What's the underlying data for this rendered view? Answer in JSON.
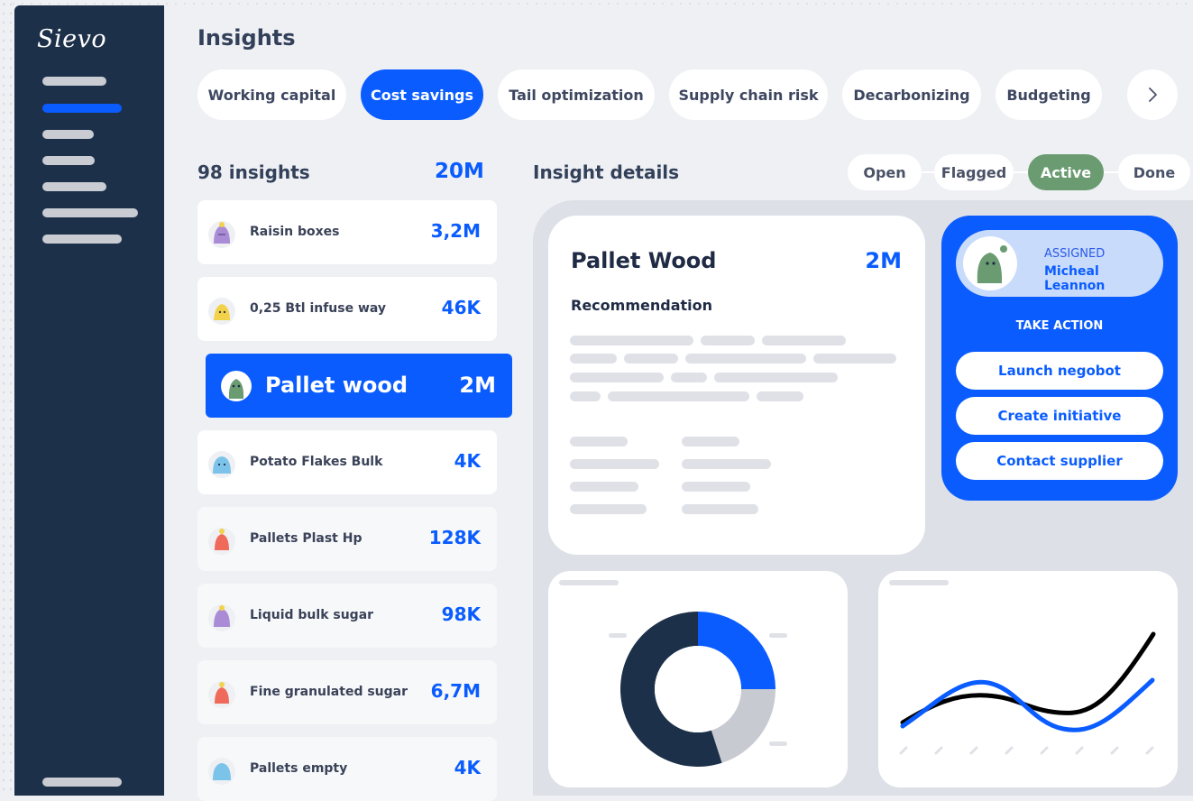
{
  "app": {
    "logo": "Sievo"
  },
  "sidebar": {
    "items": [
      "nav-item-1",
      "nav-item-2",
      "nav-item-3",
      "nav-item-4",
      "nav-item-5",
      "nav-item-6",
      "nav-item-7"
    ]
  },
  "header": {
    "title": "Insights"
  },
  "tabs": [
    {
      "label": "Working capital",
      "active": false
    },
    {
      "label": "Cost savings",
      "active": true
    },
    {
      "label": "Tail optimization",
      "active": false
    },
    {
      "label": "Supply chain risk",
      "active": false
    },
    {
      "label": "Decarbonizing",
      "active": false
    },
    {
      "label": "Budgeting",
      "active": false
    }
  ],
  "tabs_next_icon": "chevron-right-icon",
  "insights": {
    "count_label": "98 insights",
    "total": "20M",
    "items": [
      {
        "name": "Raisin boxes",
        "value": "3,2M",
        "avatar_color": "#a98bd6"
      },
      {
        "name": "0,25 Btl infuse way",
        "value": "46K",
        "avatar_color": "#f3d24b"
      },
      {
        "name": "Pallet wood",
        "value": "2M",
        "avatar_color": "#6a9b71",
        "selected": true
      },
      {
        "name": "Potato Flakes Bulk",
        "value": "4K",
        "avatar_color": "#7cc3ea"
      },
      {
        "name": "Pallets Plast Hp",
        "value": "128K",
        "avatar_color": "#ef6a5a"
      },
      {
        "name": "Liquid bulk sugar",
        "value": "98K",
        "avatar_color": "#a98bd6"
      },
      {
        "name": "Fine granulated sugar",
        "value": "6,7M",
        "avatar_color": "#ef6a5a"
      },
      {
        "name": "Pallets empty",
        "value": "4K",
        "avatar_color": "#7cc3ea"
      }
    ]
  },
  "details": {
    "title": "Insight details",
    "statuses": [
      {
        "label": "Open",
        "active": false
      },
      {
        "label": "Flagged",
        "active": false
      },
      {
        "label": "Active",
        "active": true
      },
      {
        "label": "Done",
        "active": false
      }
    ],
    "card": {
      "title": "Pallet Wood",
      "value": "2M",
      "subtitle": "Recommendation"
    },
    "assigned": {
      "label": "ASSIGNED",
      "name": "Micheal Leannon"
    },
    "take_action": "TAKE ACTION",
    "actions": [
      "Launch negobot",
      "Create initiative",
      "Contact supplier"
    ]
  },
  "colors": {
    "accent": "#0a5cff",
    "sidebar": "#1d3049",
    "active_status": "#6a9b71",
    "donut_dark": "#1d3049",
    "donut_light": "#c7cad1"
  },
  "donut": {
    "segments": [
      {
        "share": 0.25,
        "color": "#0a5cff"
      },
      {
        "share": 0.2,
        "color": "#c7cad1"
      },
      {
        "share": 0.55,
        "color": "#1d3049"
      }
    ]
  }
}
